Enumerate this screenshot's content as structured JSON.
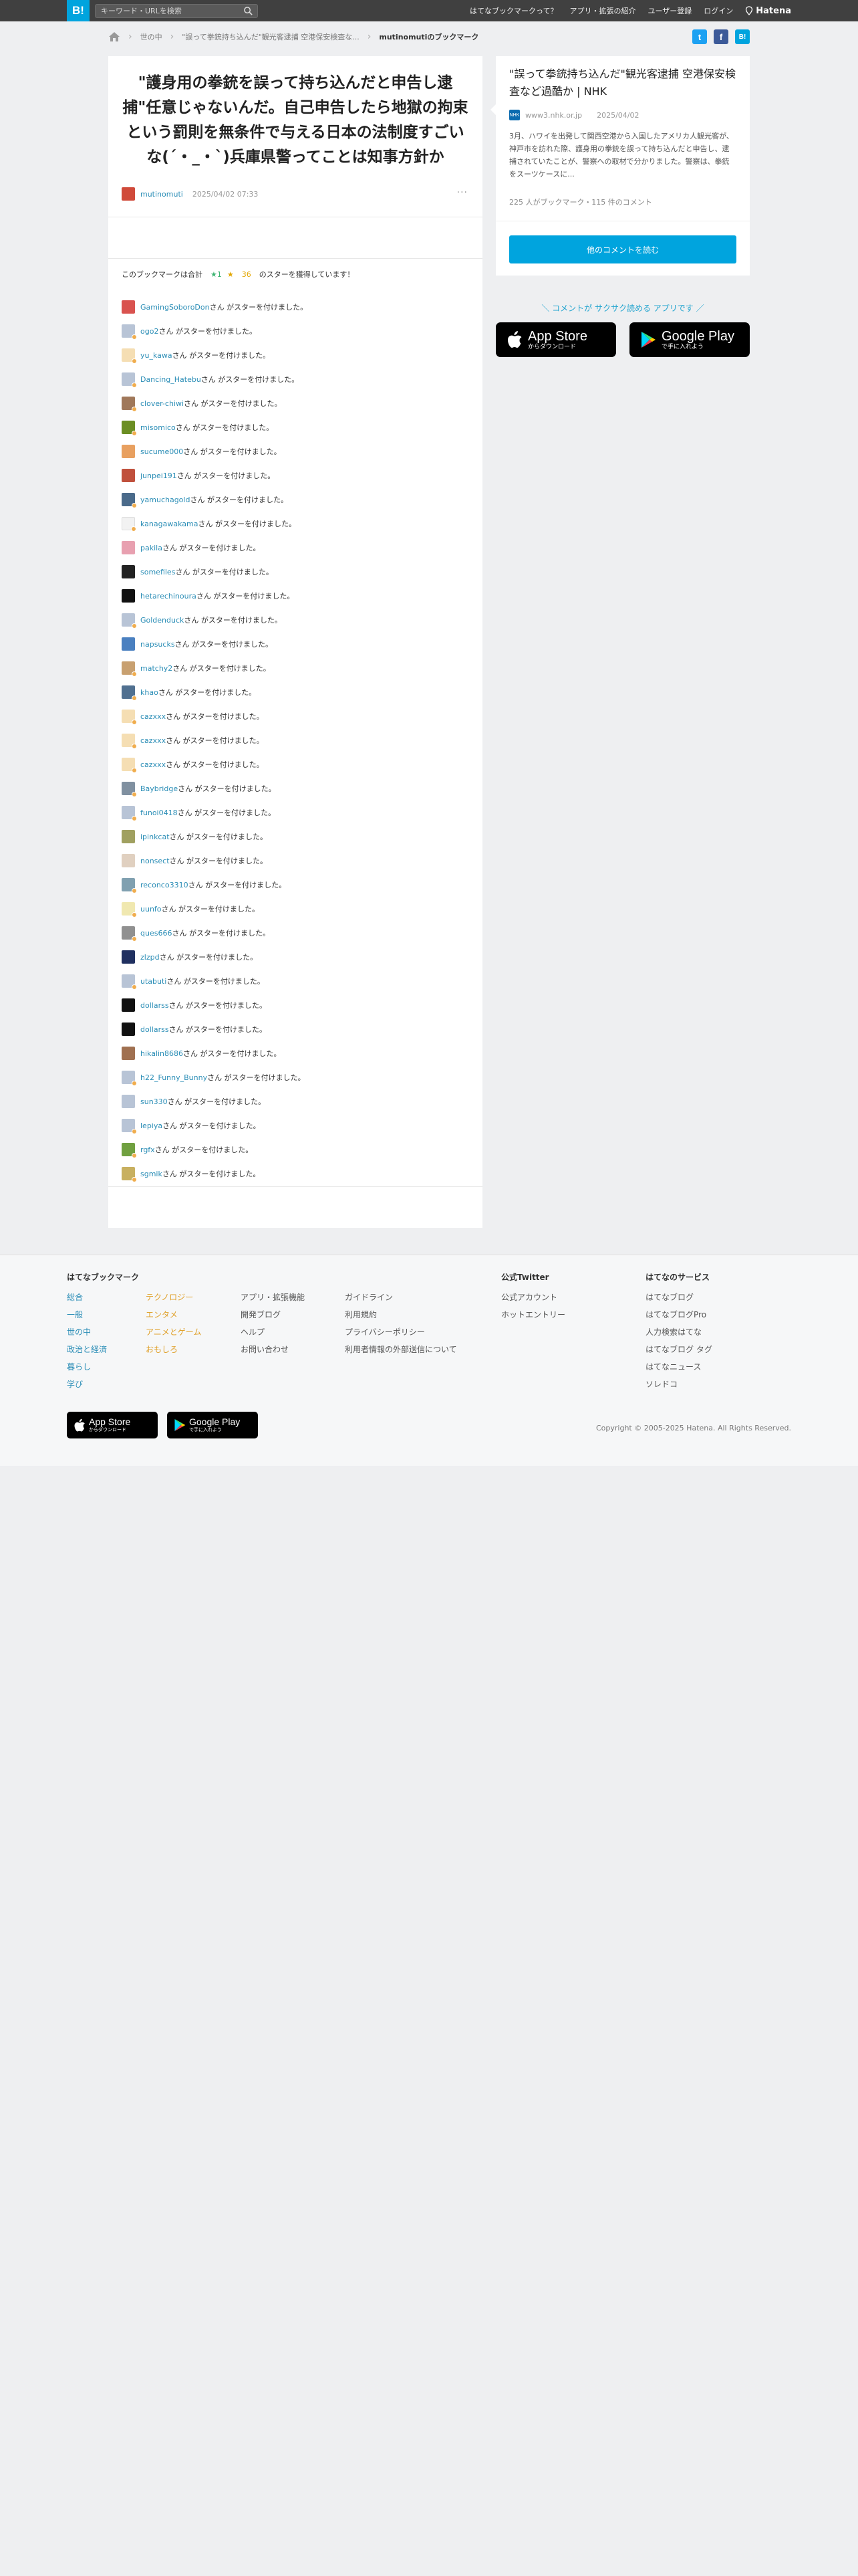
{
  "header": {
    "logo": "B!",
    "search_placeholder": "キーワード・URLを検索",
    "nav": [
      "はてなブックマークって？",
      "アプリ・拡張の紹介",
      "ユーザー登録",
      "ログイン"
    ],
    "brand": "Hatena"
  },
  "breadcrumb": {
    "category": "世の中",
    "entry": "\"誤って拳銃持ち込んだ\"観光客逮捕 空港保安検査な...",
    "current": "mutinomutiのブックマーク"
  },
  "share": {
    "twitter": "t",
    "facebook": "f",
    "hatena": "B!"
  },
  "entry": {
    "title": "\"護身用の拳銃を誤って持ち込んだと申告し逮捕\"任意じゃないんだ。自己申告したら地獄の拘束という罰則を無条件で与える日本の法制度すごいな(´・_・`)兵庫県警ってことは知事方針か",
    "user": "mutinomuti",
    "time": "2025/04/02 07:33",
    "more": "···"
  },
  "stars": {
    "prefix": "このブックマークは合計",
    "green_count": "1",
    "yellow_count": "36",
    "suffix": "のスターを獲得しています！",
    "row_suffix": "さん がスターを付けました。",
    "users": [
      {
        "name": "GamingSoboroDon",
        "color": "#d9534f",
        "badge": ""
      },
      {
        "name": "ogo2",
        "color": "#b8c4d6",
        "badge": "#f0ad4e"
      },
      {
        "name": "yu_kawa",
        "color": "#f5deb3",
        "badge": "#f0ad4e"
      },
      {
        "name": "Dancing_Hatebu",
        "color": "#b8c4d6",
        "badge": "#f0ad4e"
      },
      {
        "name": "clover-chiwi",
        "color": "#a0785a",
        "badge": "#f0ad4e"
      },
      {
        "name": "misomico",
        "color": "#6b8e23",
        "badge": "#f0ad4e"
      },
      {
        "name": "sucume000",
        "color": "#e8a060",
        "badge": ""
      },
      {
        "name": "junpei191",
        "color": "#c0503c",
        "badge": ""
      },
      {
        "name": "yamuchagold",
        "color": "#4a6a8a",
        "badge": "#f0ad4e"
      },
      {
        "name": "kanagawakama",
        "color": "#f2f2f2",
        "badge": "#f0ad4e"
      },
      {
        "name": "pakila",
        "color": "#e8a0b0",
        "badge": ""
      },
      {
        "name": "somefiles",
        "color": "#222222",
        "badge": ""
      },
      {
        "name": "hetarechinoura",
        "color": "#111111",
        "badge": ""
      },
      {
        "name": "Goldenduck",
        "color": "#b8c4d6",
        "badge": "#f0ad4e"
      },
      {
        "name": "napsucks",
        "color": "#4a80c0",
        "badge": ""
      },
      {
        "name": "matchy2",
        "color": "#c8a070",
        "badge": "#f0ad4e"
      },
      {
        "name": "khao",
        "color": "#507090",
        "badge": "#f0ad4e"
      },
      {
        "name": "cazxxx",
        "color": "#f5deb3",
        "badge": "#f0ad4e"
      },
      {
        "name": "cazxxx",
        "color": "#f5deb3",
        "badge": "#f0ad4e"
      },
      {
        "name": "cazxxx",
        "color": "#f5deb3",
        "badge": "#f0ad4e"
      },
      {
        "name": "Baybridge",
        "color": "#8090a0",
        "badge": "#f0ad4e"
      },
      {
        "name": "funoi0418",
        "color": "#b8c4d6",
        "badge": "#f0ad4e"
      },
      {
        "name": "ipinkcat",
        "color": "#a0a060",
        "badge": ""
      },
      {
        "name": "nonsect",
        "color": "#e0d0c0",
        "badge": ""
      },
      {
        "name": "reconco3310",
        "color": "#80a0b0",
        "badge": "#f0ad4e"
      },
      {
        "name": "uunfo",
        "color": "#f0e8b0",
        "badge": "#f0ad4e"
      },
      {
        "name": "ques666",
        "color": "#909090",
        "badge": "#f0ad4e"
      },
      {
        "name": "zlzpd",
        "color": "#203060",
        "badge": ""
      },
      {
        "name": "utabuti",
        "color": "#b8c4d6",
        "badge": "#f0ad4e"
      },
      {
        "name": "dollarss",
        "color": "#111111",
        "badge": ""
      },
      {
        "name": "dollarss",
        "color": "#111111",
        "badge": ""
      },
      {
        "name": "hikalin8686",
        "color": "#a07050",
        "badge": ""
      },
      {
        "name": "h22_Funny_Bunny",
        "color": "#b8c4d6",
        "badge": "#f0ad4e"
      },
      {
        "name": "sun330",
        "color": "#b8c4d6",
        "badge": ""
      },
      {
        "name": "lepiya",
        "color": "#b8c4d6",
        "badge": "#f0ad4e"
      },
      {
        "name": "rgfx",
        "color": "#70a040",
        "badge": "#f0ad4e"
      },
      {
        "name": "sgmik",
        "color": "#c8b060",
        "badge": "#f0ad4e"
      }
    ]
  },
  "side": {
    "title": "\"誤って拳銃持ち込んだ\"観光客逮捕 空港保安検査など過酷か | NHK",
    "favicon": "NHK",
    "domain": "www3.nhk.or.jp",
    "date": "2025/04/02",
    "description": "3月、ハワイを出発して関西空港から入国したアメリカ人観光客が、神戸市を訪れた際、護身用の拳銃を誤って持ち込んだと申告し、逮捕されていたことが、警察への取材で分かりました。警察は、拳銃をスーツケースに...",
    "counts": "225 人がブックマーク・115 件のコメント",
    "button": "他のコメントを読む"
  },
  "app_promo": {
    "text": "＼ コメントが サクサク読める アプリです ／",
    "appstore_small": "からダウンロード",
    "appstore_big": "App Store",
    "gplay_big": "Google Play",
    "gplay_small": "で手に入れよう"
  },
  "footer": {
    "col1_title": "はてなブックマーク",
    "col1a": [
      "総合",
      "一般",
      "世の中",
      "政治と経済",
      "暮らし",
      "学び"
    ],
    "col1b": [
      "テクノロジー",
      "エンタメ",
      "アニメとゲーム",
      "おもしろ"
    ],
    "col2": [
      "アプリ・拡張機能",
      "開発ブログ",
      "ヘルプ",
      "お問い合わせ"
    ],
    "col3": [
      "ガイドライン",
      "利用規約",
      "プライバシーポリシー",
      "利用者情報の外部送信について"
    ],
    "col4_title": "公式Twitter",
    "col4": [
      "公式アカウント",
      "ホットエントリー"
    ],
    "col5_title": "はてなのサービス",
    "col5": [
      "はてなブログ",
      "はてなブログPro",
      "人力検索はてな",
      "はてなブログ タグ",
      "はてなニュース",
      "ソレドコ"
    ],
    "copyright": "Copyright © 2005-2025 Hatena. All Rights Reserved."
  }
}
